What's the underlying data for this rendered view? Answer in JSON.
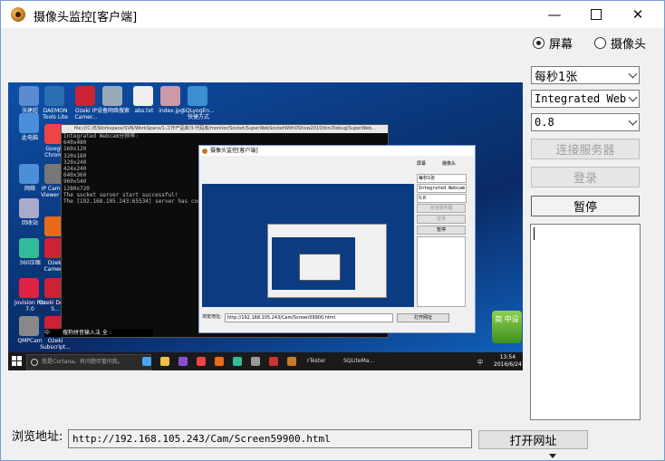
{
  "window": {
    "title": "摄像头监控[客户端]"
  },
  "source": {
    "options": [
      {
        "label": "屏幕",
        "selected": true
      },
      {
        "label": "摄像头",
        "selected": false
      }
    ]
  },
  "controls": {
    "rate_value": "每秒1张",
    "device_value": "Integrated Webcam",
    "quality_value": "0.8",
    "connect_label": "连接服务器",
    "login_label": "登录",
    "pause_label": "暂停"
  },
  "footer": {
    "url_label": "浏览地址:",
    "url_value": "http://192.168.105.243/Cam/Screen59900.html",
    "open_label": "打开网址"
  },
  "capture": {
    "desktop_icons": [
      {
        "label": "张建超",
        "color": "#5a8ccf"
      },
      {
        "label": "DAEMON Tools Lite",
        "color": "#2a6fb0"
      },
      {
        "label": "Ozeki IP Camer...",
        "color": "#c23"
      },
      {
        "label": "设备网络搜索",
        "color": "#9ab"
      },
      {
        "label": "abs.txt",
        "color": "#eee"
      },
      {
        "label": "index.jpg",
        "color": "#c9a"
      },
      {
        "label": "SQLyogEn... 快捷方式",
        "color": "#3a8fd0"
      },
      {
        "label": "此电脑",
        "color": "#4a8fd8"
      },
      {
        "label": "Google Chrome",
        "color": "#e44"
      },
      {
        "label": "网络",
        "color": "#4a8fd8"
      },
      {
        "label": "IP Camera Viewer 1.3",
        "color": "#777"
      },
      {
        "label": "回收站",
        "color": "#aac"
      },
      {
        "label": "Mozilla Firefox",
        "color": "#e86a1a"
      },
      {
        "label": "360压缩",
        "color": "#3b9"
      },
      {
        "label": "Ozeki Camer...",
        "color": "#c23"
      },
      {
        "label": "Jovision Pro 7.0",
        "color": "#d24"
      },
      {
        "label": "Ozeki Demo S...",
        "color": "#c23"
      },
      {
        "label": "QMPCam",
        "color": "#888"
      },
      {
        "label": "Ozeki Subscript...",
        "color": "#c23"
      }
    ],
    "console_title": "file:///C:/E/Workspace/SVN/WorkSpace/1-工作产品库/3-代码库/monitor/Socket/SuperWebSocketWithDShow2010/bin/Debug/SuperWeb...",
    "console_lines": [
      "Integrated Webcam分辨率:",
      "640x480",
      "160x120",
      "320x180",
      "320x240",
      "424x240",
      "640x360",
      "960x540",
      "1280x720",
      "The socket server start successful!",
      "The [192.168.105.243:65534] server has connect"
    ],
    "inner_title": "摄像头监控[客户端]",
    "inner_radio_screen": "屏幕",
    "inner_radio_camera": "摄像头",
    "inner_rate": "每秒1张",
    "inner_device": "Integrated Webcam",
    "inner_quality": "0.8",
    "inner_connect": "连接服务器",
    "inner_login": "登录",
    "inner_pause": "暂停",
    "inner_url_label": "浏览地址:",
    "inner_url": "http://192.168.105.243/Cam/Screen59900.html",
    "inner_open": "打开网址",
    "ime_label": "中",
    "ime_text": "搜狗拼音输入法 全 :",
    "taskbar_search": "我是Cortana。有问题尽管问我。",
    "taskbar_apps": [
      "rTester",
      "SQLiteMa..."
    ],
    "tray_time": "13:54",
    "tray_date": "2016/6/24",
    "tray_ime": "中",
    "badge_text": "简 中设"
  },
  "colors": {
    "accent_border": "#7a9bd0",
    "desktop_blue": "#0b3c82"
  }
}
